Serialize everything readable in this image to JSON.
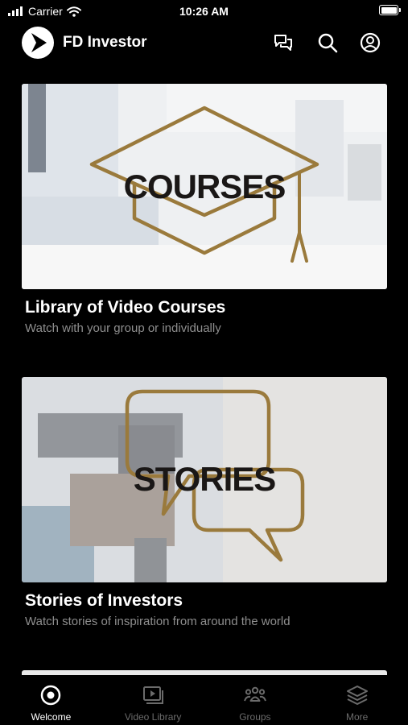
{
  "status_bar": {
    "carrier": "Carrier",
    "time": "10:26 AM"
  },
  "header": {
    "title": "FD Investor",
    "icons": [
      "chat-icon",
      "search-icon",
      "profile-icon"
    ]
  },
  "cards": [
    {
      "overlay_text": "COURSES",
      "title": "Library of Video Courses",
      "subtitle": "Watch with your group or individually"
    },
    {
      "overlay_text": "STORIES",
      "title": "Stories of Investors",
      "subtitle": "Watch stories of inspiration from around the world"
    }
  ],
  "tabs": [
    {
      "label": "Welcome",
      "icon": "target-icon",
      "active": true
    },
    {
      "label": "Video Library",
      "icon": "video-icon",
      "active": false
    },
    {
      "label": "Groups",
      "icon": "groups-icon",
      "active": false
    },
    {
      "label": "More",
      "icon": "layers-icon",
      "active": false
    }
  ],
  "colors": {
    "accent_gold": "#9a7a3c",
    "background": "#000000",
    "inactive": "#6b6b6b"
  }
}
